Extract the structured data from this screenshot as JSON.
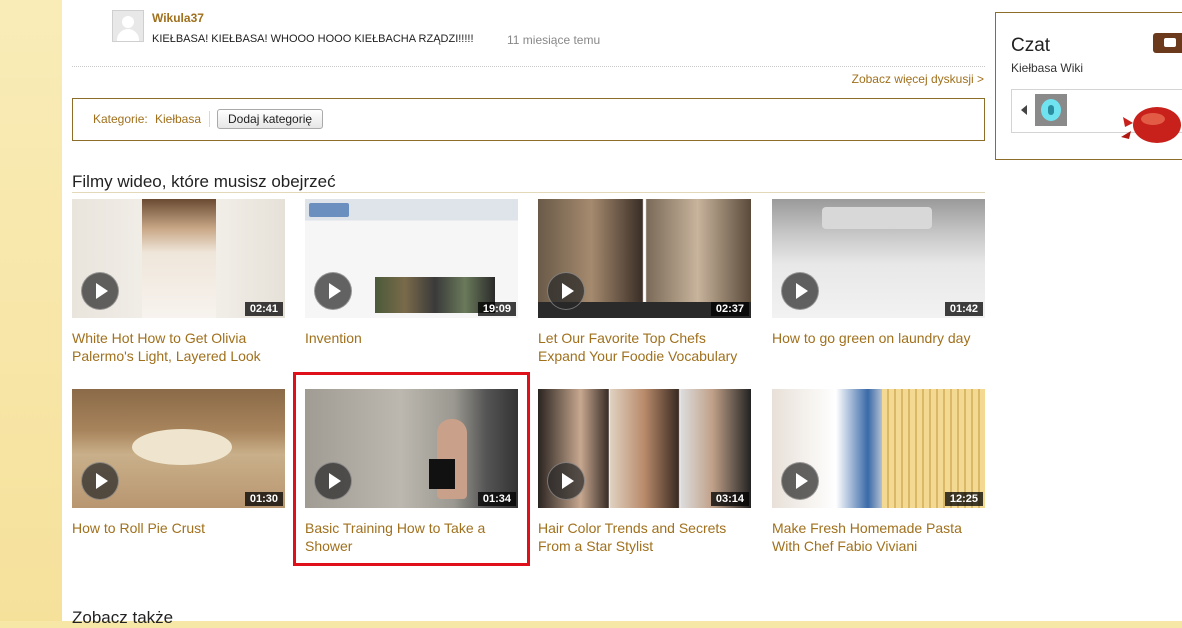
{
  "comment": {
    "user": "Wikula37",
    "text": "KIEŁBASA! KIEŁBASA! WHOOO HOOO KIEŁBACHA RZĄDZI!!!!!",
    "time": "11 miesiące temu"
  },
  "discussion": {
    "more_link": "Zobacz więcej dyskusji >"
  },
  "categories": {
    "label": "Kategorie:",
    "items": [
      "Kiełbasa"
    ],
    "add_button": "Dodaj kategorię"
  },
  "videos": {
    "heading": "Filmy wideo, które musisz obejrzeć",
    "items": [
      {
        "title": "White Hot How to Get Olivia Palermo's Light, Layered Look",
        "duration": "02:41"
      },
      {
        "title": "Invention",
        "duration": "19:09"
      },
      {
        "title": "Let Our Favorite Top Chefs Expand Your Foodie Vocabulary",
        "duration": "02:37"
      },
      {
        "title": "How to go green on laundry day",
        "duration": "01:42"
      },
      {
        "title": "How to Roll Pie Crust",
        "duration": "01:30"
      },
      {
        "title": "Basic Training How to Take a Shower",
        "duration": "01:34"
      },
      {
        "title": "Hair Color Trends and Secrets From a Star Stylist",
        "duration": "03:14"
      },
      {
        "title": "Make Fresh Homemade Pasta With Chef Fabio Viviani",
        "duration": "12:25"
      }
    ]
  },
  "see_also": {
    "heading": "Zobacz także"
  },
  "chat": {
    "title": "Czat",
    "subtitle": "Kiełbasa Wiki",
    "icon": "chat-bubble-icon",
    "accent": "#6b3a1c"
  },
  "colors": {
    "link": "#a0701c",
    "border": "#8c6d2a",
    "highlight": "#e0101a",
    "page_background": "#f7e7a6"
  }
}
